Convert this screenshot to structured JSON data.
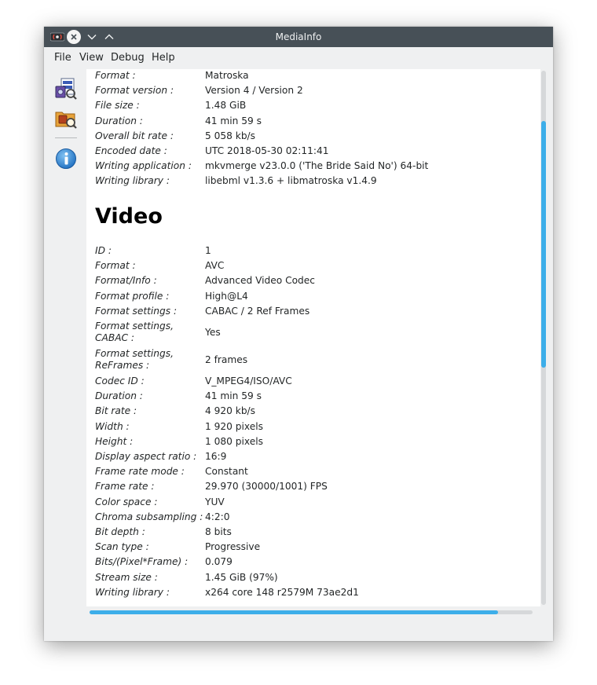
{
  "window": {
    "title": "MediaInfo"
  },
  "menu": {
    "file": "File",
    "view": "View",
    "debug": "Debug",
    "help": "Help"
  },
  "toolbar": {
    "icons": [
      "open-file-icon",
      "open-folder-icon",
      "info-icon"
    ]
  },
  "general_rows": [
    {
      "key": "Format :",
      "value": "Matroska"
    },
    {
      "key": "Format version :",
      "value": "Version 4 / Version 2"
    },
    {
      "key": "File size :",
      "value": "1.48 GiB"
    },
    {
      "key": "Duration :",
      "value": "41 min 59 s"
    },
    {
      "key": "Overall bit rate :",
      "value": "5 058 kb/s"
    },
    {
      "key": "Encoded date :",
      "value": "UTC 2018-05-30 02:11:41"
    },
    {
      "key": "Writing application :",
      "value": "mkvmerge v23.0.0 ('The Bride Said No') 64-bit"
    },
    {
      "key": "Writing library :",
      "value": "libebml v1.3.6 + libmatroska v1.4.9"
    }
  ],
  "video_section": {
    "title": "Video"
  },
  "video_rows": [
    {
      "key": "ID :",
      "value": "1"
    },
    {
      "key": "Format :",
      "value": "AVC"
    },
    {
      "key": "Format/Info :",
      "value": "Advanced Video Codec"
    },
    {
      "key": "Format profile :",
      "value": "High@L4"
    },
    {
      "key": "Format settings :",
      "value": "CABAC / 2 Ref Frames"
    },
    {
      "key": "Format settings, CABAC :",
      "value": "Yes"
    },
    {
      "key": "Format settings, ReFrames :",
      "value": "2 frames"
    },
    {
      "key": "Codec ID :",
      "value": "V_MPEG4/ISO/AVC"
    },
    {
      "key": "Duration :",
      "value": "41 min 59 s"
    },
    {
      "key": "Bit rate :",
      "value": "4 920 kb/s"
    },
    {
      "key": "Width :",
      "value": "1 920 pixels"
    },
    {
      "key": "Height :",
      "value": "1 080 pixels"
    },
    {
      "key": "Display aspect ratio :",
      "value": "16:9"
    },
    {
      "key": "Frame rate mode :",
      "value": "Constant"
    },
    {
      "key": "Frame rate :",
      "value": "29.970 (30000/1001) FPS"
    },
    {
      "key": "Color space :",
      "value": "YUV"
    },
    {
      "key": "Chroma subsampling :",
      "value": "4:2:0"
    },
    {
      "key": "Bit depth :",
      "value": "8 bits"
    },
    {
      "key": "Scan type :",
      "value": "Progressive"
    },
    {
      "key": "Bits/(Pixel*Frame) :",
      "value": "0.079"
    },
    {
      "key": "Stream size :",
      "value": "1.45 GiB (97%)"
    },
    {
      "key": "Writing library :",
      "value": "x264 core 148 r2579M 73ae2d1"
    }
  ],
  "colors": {
    "titlebar": "#475057",
    "accent": "#3daee9",
    "window_bg": "#eff0f1"
  },
  "scroll": {
    "vertical_position": 0.1,
    "horizontal_position": 0.92
  }
}
